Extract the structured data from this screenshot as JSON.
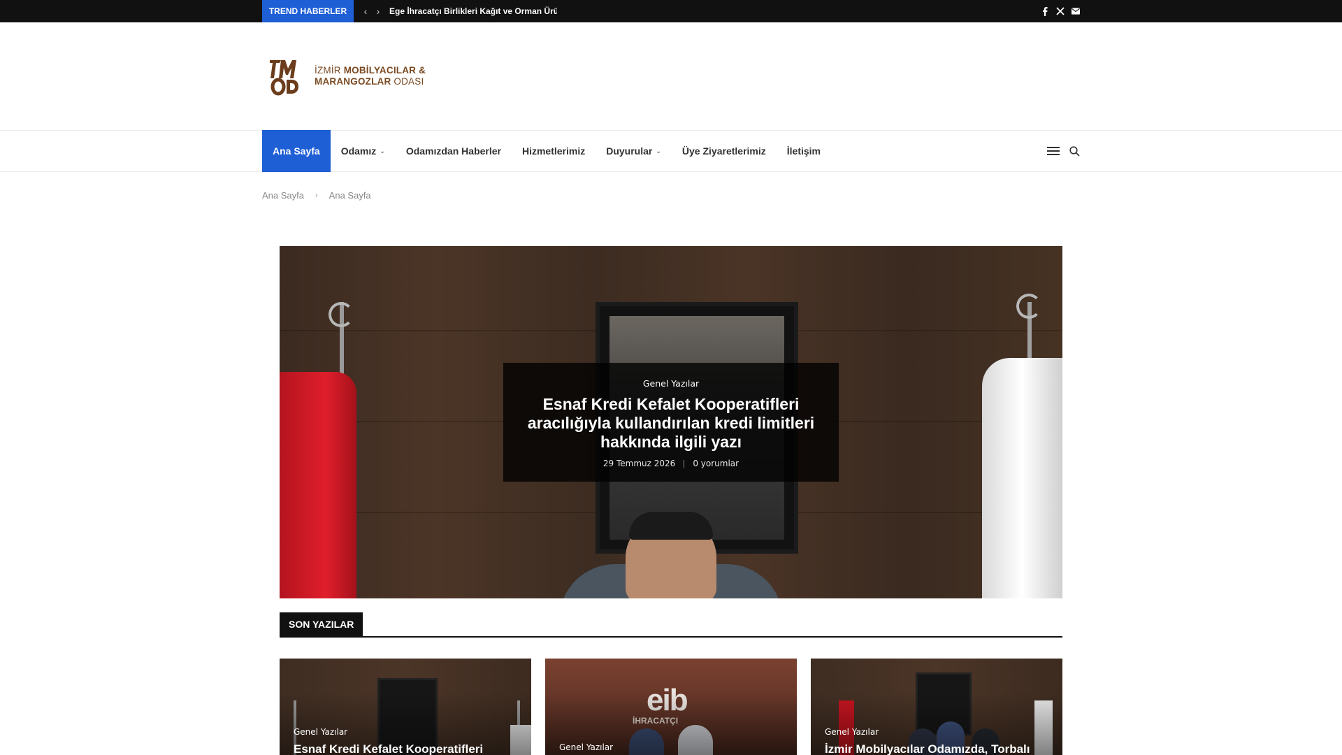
{
  "topbar": {
    "trend_label": "TREND HABERLER",
    "trend_text": "Ege İhracatçı Birlikleri Kağıt ve Orman Ürünle",
    "social_icons": [
      "facebook-icon",
      "x-twitter-icon",
      "envelope-icon"
    ]
  },
  "logo": {
    "line1_light": "İZMİR ",
    "line1_bold": "MOBİLYACILAR &",
    "line2_bold": "MARANGOZLAR ",
    "line2_light": "ODASI",
    "brand_color": "#7a4a22"
  },
  "nav": {
    "items": [
      {
        "label": "Ana Sayfa",
        "active": true,
        "dropdown": false
      },
      {
        "label": "Odamız",
        "active": false,
        "dropdown": true
      },
      {
        "label": "Odamızdan Haberler",
        "active": false,
        "dropdown": false
      },
      {
        "label": "Hizmetlerimiz",
        "active": false,
        "dropdown": false
      },
      {
        "label": "Duyurular",
        "active": false,
        "dropdown": true
      },
      {
        "label": "Üye Ziyaretlerimiz",
        "active": false,
        "dropdown": false
      },
      {
        "label": "İletişim",
        "active": false,
        "dropdown": false
      }
    ],
    "right_icons": [
      "hamburger-menu-icon",
      "search-icon"
    ],
    "accent": "#1e5fd6"
  },
  "breadcrumb": {
    "items": [
      "Ana Sayfa",
      "Ana Sayfa"
    ]
  },
  "hero": {
    "category": "Genel Yazılar",
    "title": "Esnaf Kredi Kefalet Kooperatifleri aracılığıyla kullandırılan kredi limitleri hakkında ilgili yazı",
    "date": "29 Temmuz 2026",
    "comments": "0 yorumlar"
  },
  "section": {
    "label": "SON YAZILAR"
  },
  "cards": [
    {
      "category": "Genel Yazılar",
      "title": "Esnaf Kredi Kefalet Kooperatifleri"
    },
    {
      "category": "Genel Yazılar",
      "title": ""
    },
    {
      "category": "Genel Yazılar",
      "title": "İzmir Mobilyacılar Odamızda, Torbalı"
    }
  ]
}
